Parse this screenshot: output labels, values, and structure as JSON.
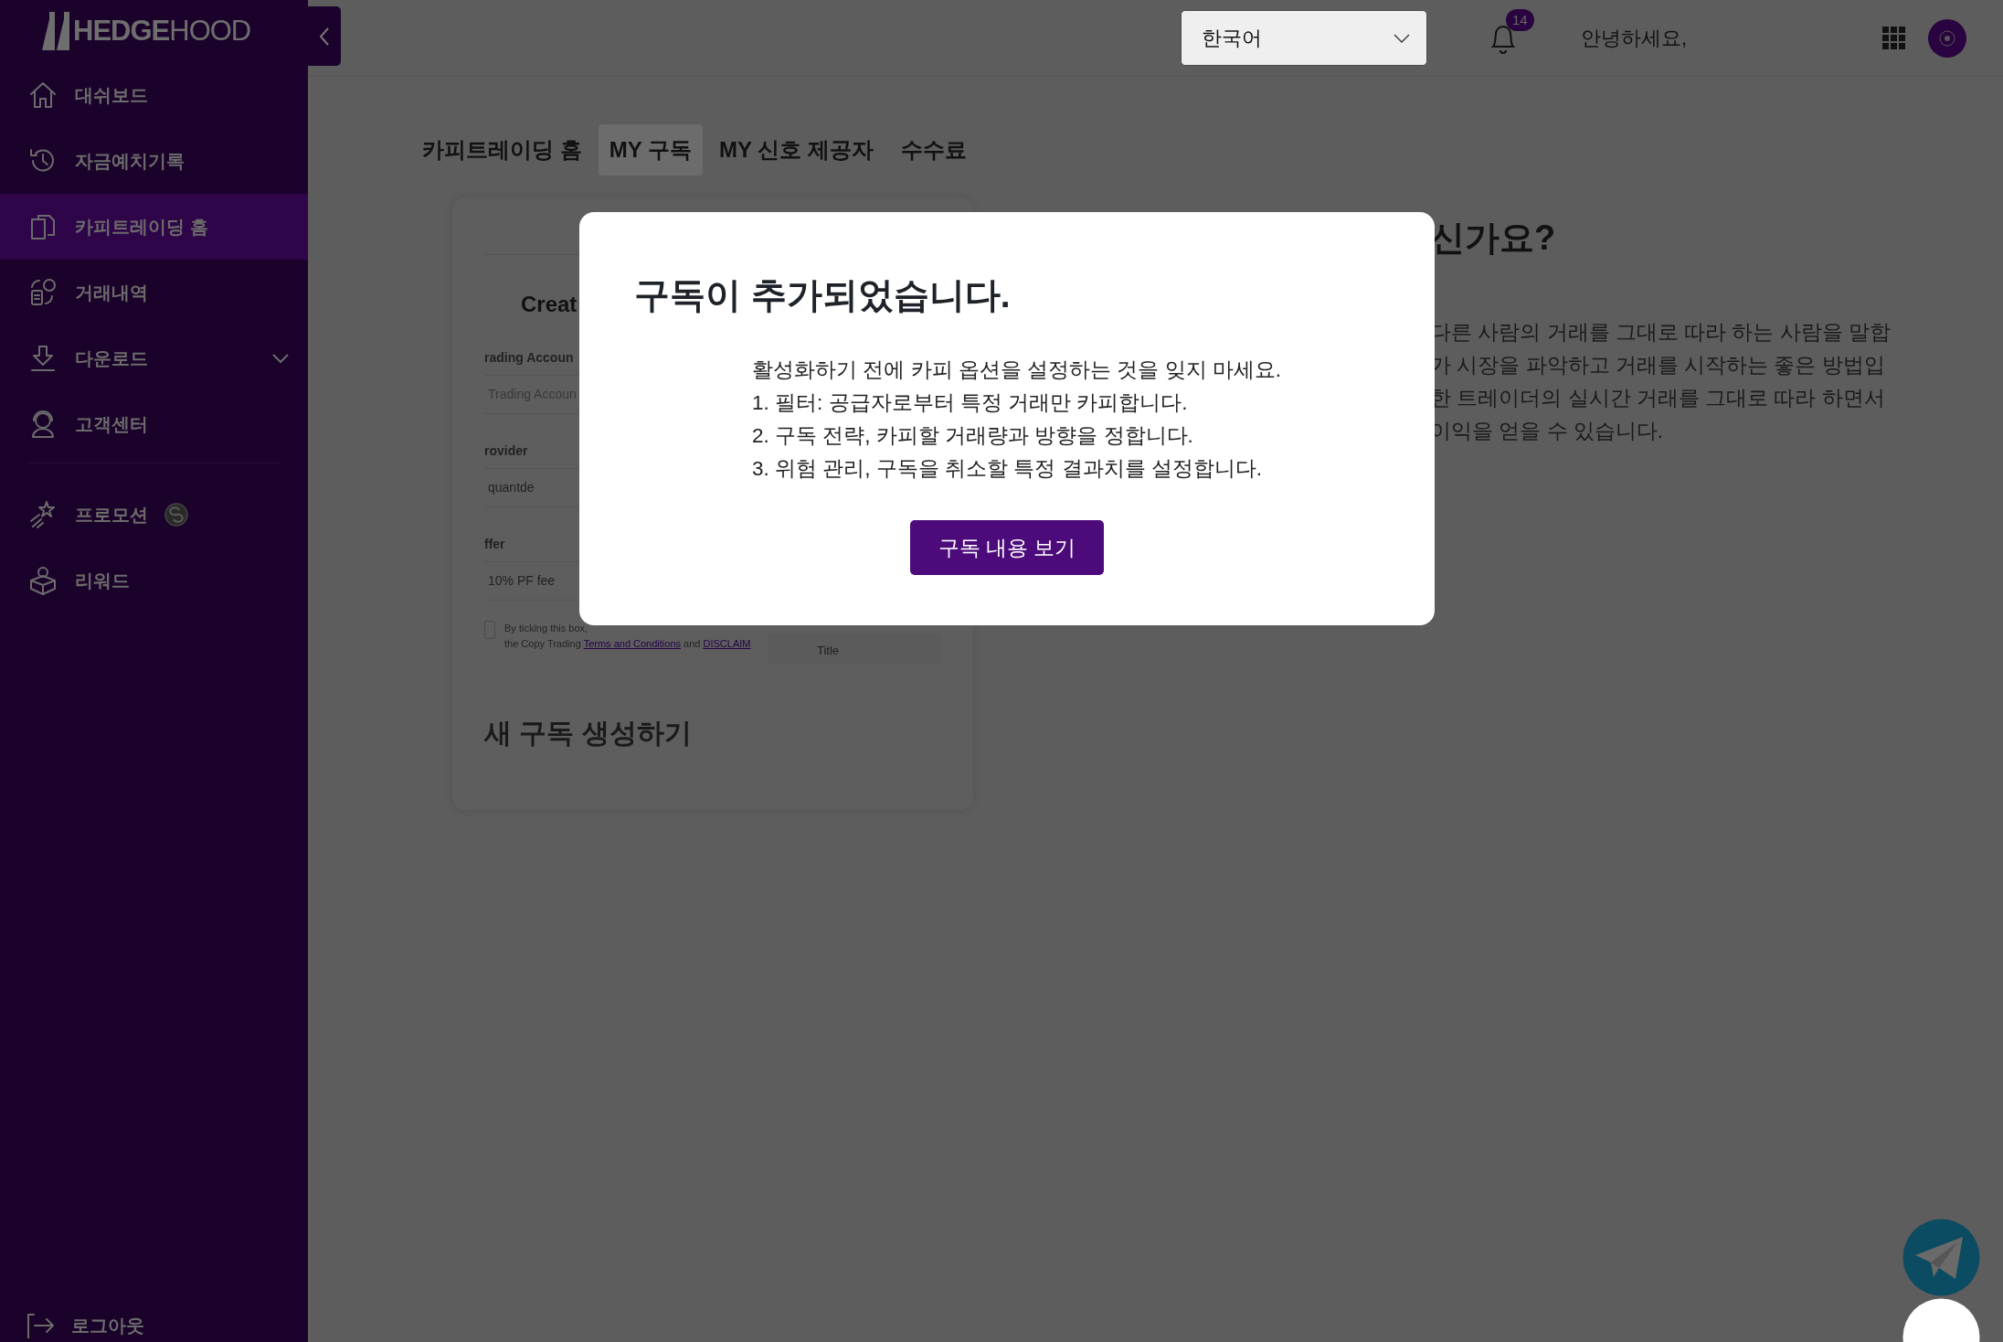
{
  "sidebar": {
    "logo": "**HEDGE**HOOD",
    "items": [
      {
        "kind": "link",
        "label": "대쉬보드",
        "selected": false
      },
      {
        "kind": "link",
        "label": "자금예치기록",
        "selected": false
      },
      {
        "kind": "link",
        "label": "카피트레이딩 홈",
        "selected": true
      },
      {
        "kind": "link",
        "label": "거래내역",
        "selected": false
      },
      {
        "kind": "dropdown",
        "label": "다운로드",
        "selected": false,
        "expanded": false
      },
      {
        "kind": "link",
        "label": "고객센터",
        "selected": false
      },
      {
        "kind": "divider"
      },
      {
        "kind": "promo",
        "label": "프로모션",
        "selected": false
      },
      {
        "kind": "link",
        "label": "리워드",
        "selected": false
      }
    ],
    "logout": "로그아웃"
  },
  "header": {
    "language": "한국어",
    "notification_count": "14",
    "greeting": "안녕하세요,"
  },
  "tabs": [
    {
      "label": "카피트레이딩 홈",
      "selected": false
    },
    {
      "label": "MY 구독",
      "selected": true
    },
    {
      "label": "MY 신호 제공자",
      "selected": false
    },
    {
      "label": "수수료",
      "selected": false
    }
  ],
  "card": {
    "screenshot": {
      "title": "Creat",
      "fields": [
        {
          "label": "rading Accoun",
          "placeholder": "Trading Accoun"
        },
        {
          "label": "rovider",
          "value": "quantde"
        },
        {
          "label": "ffer",
          "value": "10% PF fee"
        }
      ],
      "consent_checked": false,
      "consent": "By ticking this box,",
      "consent_line2": "the Copy Trading",
      "terms_link": "Terms and Conditions",
      "and": "and",
      "disclaimer_link": "DISCLAIM",
      "side_label": "Title"
    },
    "heading": "새 구독 생성하기"
  },
  "intro": {
    "heading": "신가요?",
    "lines": [
      "다른 사람의 거래를 그대로 따라 하는 사람을 말합",
      "가 시장을 파악하고 거래를 시작하는 좋은 방법입",
      "한 트레이더의 실시간 거래를 그대로 따라 하면서",
      "이익을 얻을 수 있습니다."
    ]
  },
  "modal": {
    "title": "구독이 추가되었습니다.",
    "lines": [
      "활성화하기 전에 카피 옵션을 설정하는 것을 잊지 마세요.",
      "1. 필터: 공급자로부터 특정 거래만 카피합니다.",
      "2. 구독 전략, 카피할 거래량과 방향을 정합니다.",
      "3. 위험 관리, 구독을 취소할 특정 결과치를 설정합니다."
    ],
    "button": "구독 내용 보기"
  }
}
